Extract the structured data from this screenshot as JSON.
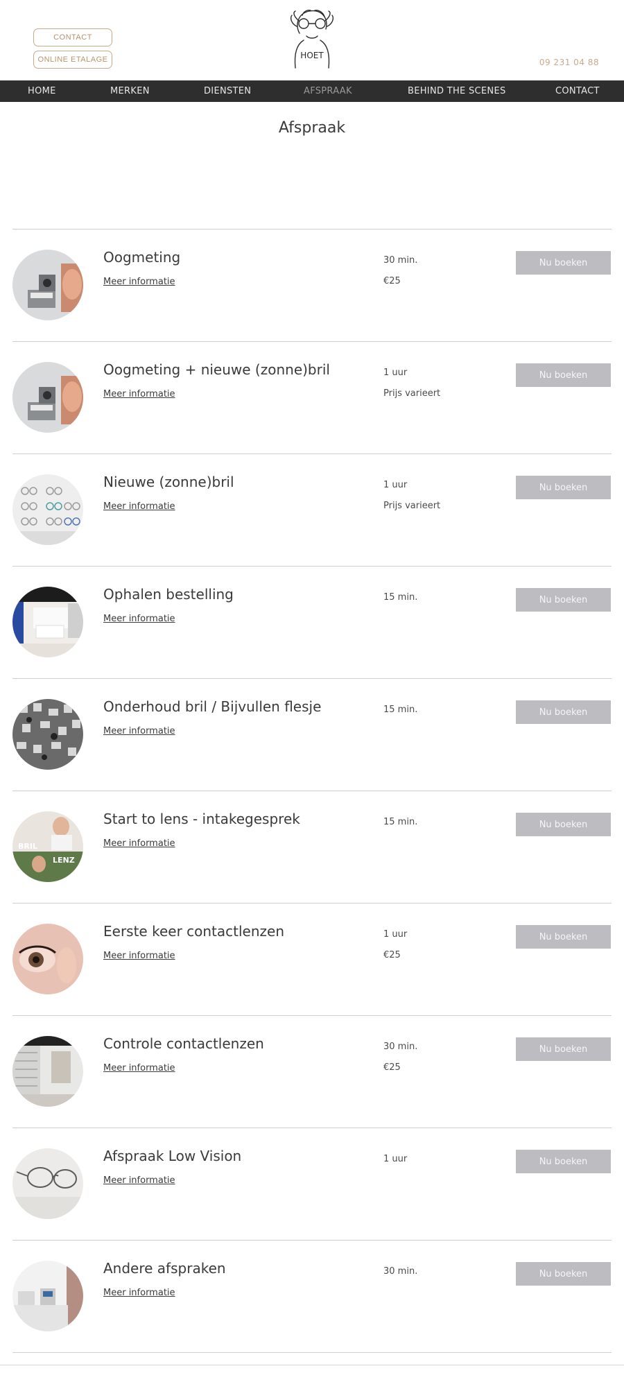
{
  "header": {
    "contact_button": "CONTACT",
    "etalage_button": "ONLINE ETALAGE",
    "logo_text": "HOET",
    "phone": "09 231 04 88"
  },
  "nav": {
    "items": [
      {
        "label": "HOME"
      },
      {
        "label": "MERKEN"
      },
      {
        "label": "DIENSTEN"
      },
      {
        "label": "AFSPRAAK",
        "active": true
      },
      {
        "label": "BEHIND THE SCENES"
      },
      {
        "label": "CONTACT"
      }
    ]
  },
  "page": {
    "title": "Afspraak"
  },
  "services": [
    {
      "title": "Oogmeting",
      "link": "Meer informatie",
      "duration": "30 min.",
      "price": "€25",
      "button": "Nu boeken",
      "image": "eye-exam-photo"
    },
    {
      "title": "Oogmeting + nieuwe (zonne)bril",
      "link": "Meer informatie",
      "duration": "1 uur",
      "price": "Prijs varieert",
      "button": "Nu boeken",
      "image": "eye-exam-photo"
    },
    {
      "title": "Nieuwe (zonne)bril",
      "link": "Meer informatie",
      "duration": "1 uur",
      "price": "Prijs varieert",
      "button": "Nu boeken",
      "image": "glasses-display-photo"
    },
    {
      "title": "Ophalen bestelling",
      "link": "Meer informatie",
      "duration": "15 min.",
      "price": "",
      "button": "Nu boeken",
      "image": "store-interior-photo"
    },
    {
      "title": "Onderhoud bril / Bijvullen flesje",
      "link": "Meer informatie",
      "duration": "15 min.",
      "price": "",
      "button": "Nu boeken",
      "image": "glasses-wall-photo"
    },
    {
      "title": "Start to lens - intakegesprek",
      "link": "Meer informatie",
      "duration": "15 min.",
      "price": "",
      "button": "Nu boeken",
      "image": "bril-lenzen-photo",
      "image_text": [
        "BRIL",
        "LENZ"
      ]
    },
    {
      "title": "Eerste keer contactlenzen",
      "link": "Meer informatie",
      "duration": "1 uur",
      "price": "€25",
      "button": "Nu boeken",
      "image": "contact-lens-eye-photo"
    },
    {
      "title": "Controle contactlenzen",
      "link": "Meer informatie",
      "duration": "30 min.",
      "price": "€25",
      "button": "Nu boeken",
      "image": "store-shelves-photo"
    },
    {
      "title": "Afspraak Low Vision",
      "link": "Meer informatie",
      "duration": "1 uur",
      "price": "",
      "button": "Nu boeken",
      "image": "glasses-closeup-photo"
    },
    {
      "title": "Andere afspraken",
      "link": "Meer informatie",
      "duration": "30 min.",
      "price": "",
      "button": "Nu boeken",
      "image": "counter-interior-photo"
    }
  ],
  "colors": {
    "accent": "#c9a98a",
    "nav_bg": "#2e2e2e",
    "button_bg": "#bdbcc1"
  }
}
